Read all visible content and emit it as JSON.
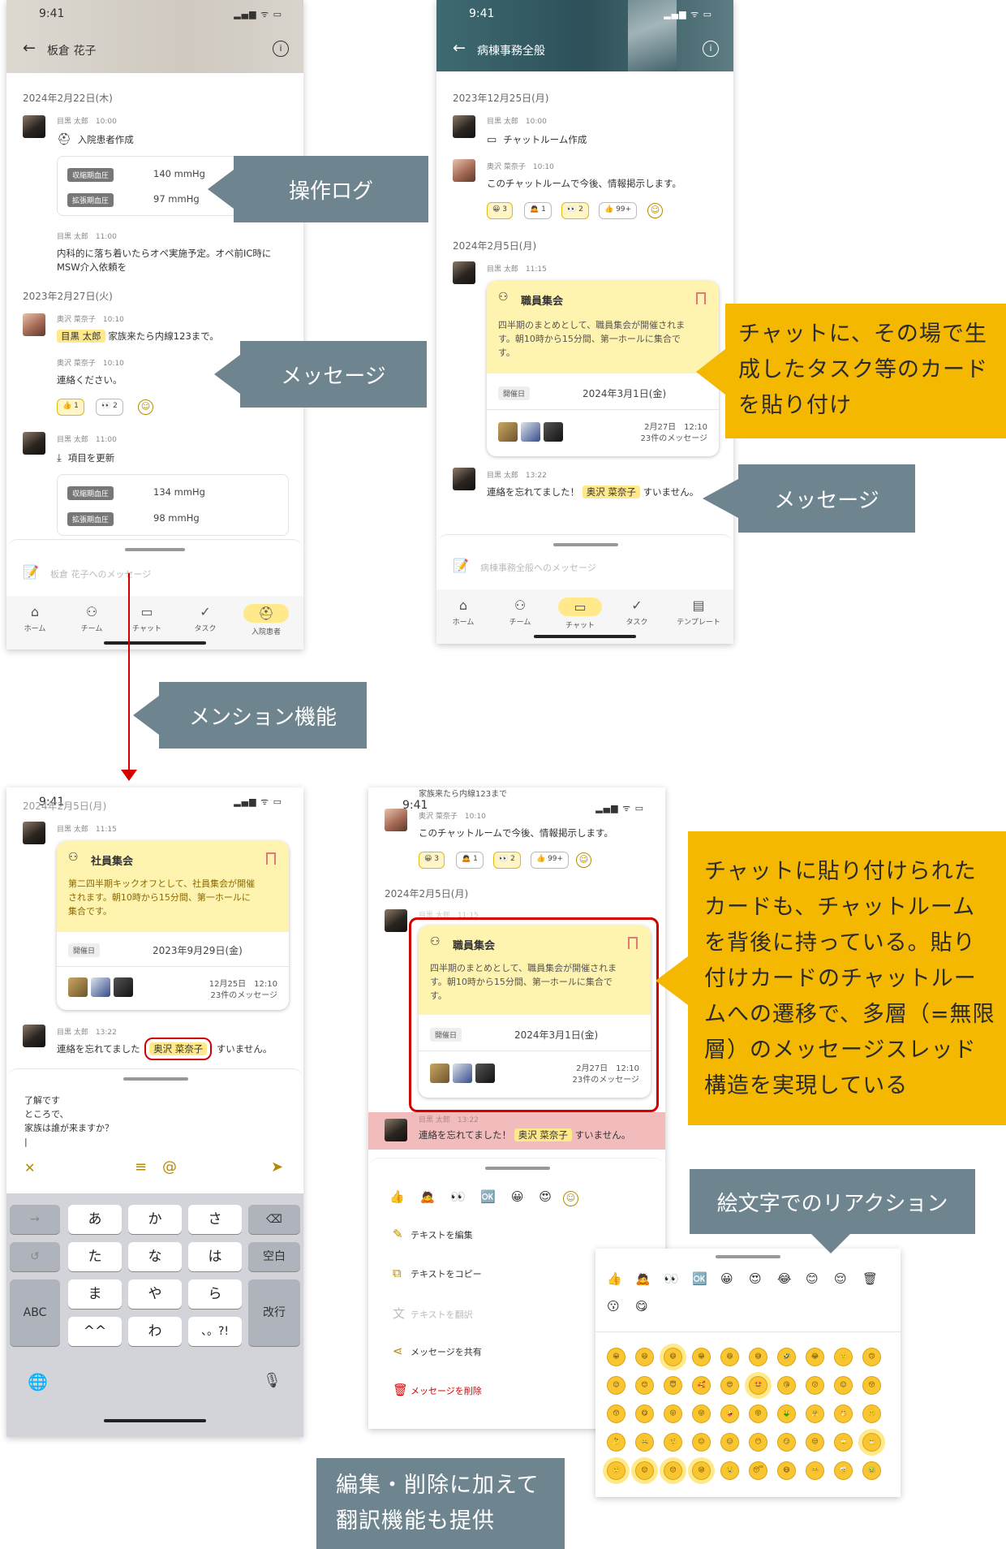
{
  "callouts": {
    "operation_log": "操作ログ",
    "message_1": "メッセージ",
    "card_paste": [
      "チャットに、その場で生",
      "成したタスク等のカード",
      "を貼り付け"
    ],
    "message_2": "メッセージ",
    "mention": "メンション機能",
    "card_thread": [
      "チャットに貼り付けられた",
      "カードも、チャットルーム",
      "を背後に持っている。貼り",
      "付けカードのチャットルー",
      "ムへの遷移で、多層（=無限",
      "層）のメッセージスレッド",
      "構造を実現している"
    ],
    "emoji_reaction": "絵文字でのリアクション",
    "edit_delete": [
      "編集・削除に加えて",
      "翻訳機能も提供"
    ]
  },
  "common": {
    "time": "9:41",
    "status_icons": "▂▄▆ ᯤ ▭",
    "back": "←",
    "info": "i"
  },
  "screen1": {
    "title": "板倉 花子",
    "date1": "2024年2月22日(木)",
    "m1_meta": "目黒 太郎　10:00",
    "m1_action": "入院患者作成",
    "vital_sys_label": "収縮期血圧",
    "vital_sys_value": "140 mmHg",
    "vital_dia_label": "拡張期血圧",
    "vital_dia_value": "97 mmHg",
    "m2_meta": "目黒 太郎　11:00",
    "m2_text_1": "内科的に落ち着いたらオペ実施予定。オペ前IC時に",
    "m2_text_2": "MSW介入依頼を",
    "date2": "2023年2月27日(火)",
    "m3_meta": "奥沢 菜奈子　10:10",
    "m3_mention": "目黒 太郎",
    "m3_text": "家族来たら内線123まで。",
    "m4_meta": "奥沢 菜奈子　10:10",
    "m4_text": "連絡ください。",
    "r1": "👍 1",
    "r2": "👀 2",
    "m5_meta": "目黒 太郎　11:00",
    "m5_action": "項目を更新",
    "vital2_sys_value": "134 mmHg",
    "vital2_dia_value": "98 mmHg",
    "input_placeholder": "板倉 花子へのメッセージ",
    "tabs": [
      "ホーム",
      "チーム",
      "チャット",
      "タスク",
      "入院患者"
    ]
  },
  "screen2": {
    "title": "病棟事務全般",
    "date1": "2023年12月25日(月)",
    "m1_meta": "目黒 太郎　10:00",
    "m1_action": "チャットルーム作成",
    "m2_meta": "奥沢 菜奈子　10:10",
    "m2_text": "このチャットルームで今後、情報掲示します。",
    "reactions": [
      "😀 3",
      "🙇 1",
      "👀 2",
      "👍 99+"
    ],
    "date2": "2024年2月5日(月)",
    "m3_meta": "目黒 太郎　11:15",
    "card_title": "職員集会",
    "card_body": [
      "四半期のまとめとして、職員集会が開催されま",
      "す。朝10時から15分間、第一ホールに集合で",
      "す。"
    ],
    "card_date_label": "開催日",
    "card_date": "2024年3月1日(金)",
    "card_footer_1": "2月27日　12:10",
    "card_footer_2": "23件のメッセージ",
    "m4_meta": "目黒 太郎　13:22",
    "m4_text_a": "連絡を忘れてました！",
    "m4_mention": "奥沢 菜奈子",
    "m4_text_b": "すいません。",
    "input_placeholder": "病棟事務全般へのメッセージ",
    "tabs": [
      "ホーム",
      "チーム",
      "チャット",
      "タスク",
      "テンプレート"
    ]
  },
  "screen3": {
    "date_behind": "2024年2月5日(月)",
    "m1_meta": "目黒 太郎　11:15",
    "card_title": "社員集会",
    "card_body": [
      "第二四半期キックオフとして、社員集会が開催",
      "されます。朝10時から15分間、第一ホールに",
      "集合です。"
    ],
    "card_date_label": "開催日",
    "card_date": "2023年9月29日(金)",
    "card_footer_1": "12月25日　12:10",
    "card_footer_2": "23件のメッセージ",
    "m2_meta": "目黒 太郎　13:22",
    "m2_text_a": "連絡を忘れてました",
    "m2_mention": "奥沢 菜奈子",
    "m2_text_b": "すいません。",
    "compose": [
      "了解です",
      "ところで、",
      "家族は誰が来ますか？"
    ],
    "close": "✕",
    "list_icon": "≡",
    "at_icon": "@",
    "send_icon": "➤",
    "keys": [
      "→",
      "あ",
      "か",
      "さ",
      "⌫",
      "↺",
      "た",
      "な",
      "は",
      "空白",
      "ABC",
      "ま",
      "や",
      "ら",
      "改行",
      "^^",
      "わ",
      "、。?!"
    ],
    "globe": "🌐",
    "mic": "🎙"
  },
  "screen4": {
    "top_text": "家族来たら内線123まで",
    "m1_meta": "奥沢 菜奈子　10:10",
    "m1_text": "このチャットルームで今後、情報掲示します。",
    "reactions": [
      "😀 3",
      "🙇 1",
      "👀 2",
      "👍 99+"
    ],
    "date": "2024年2月5日(月)",
    "m2_meta": "目黒 太郎　11:15",
    "card_title": "職員集会",
    "card_body": [
      "四半期のまとめとして、職員集会が開催されま",
      "す。朝10時から15分間、第一ホールに集合で",
      "す。"
    ],
    "card_date_label": "開催日",
    "card_date": "2024年3月1日(金)",
    "card_footer_1": "2月27日　12:10",
    "card_footer_2": "23件のメッセージ",
    "m3_meta": "目黒 太郎　13:22",
    "m3_text_a": "連絡を忘れてました！",
    "m3_mention": "奥沢 菜奈子",
    "m3_text_b": "すいません。",
    "quick_emoji": [
      "👍",
      "🙇",
      "👀",
      "🆗",
      "😀",
      "😍"
    ],
    "menu": [
      "テキストを編集",
      "テキストをコピー",
      "テキストを翻訳",
      "メッセージを共有",
      "メッセージを削除"
    ],
    "menu_icons": [
      "✎",
      "⧉",
      "文",
      "⋖",
      "🗑"
    ]
  },
  "emoji_panel": {
    "recent": [
      "👍",
      "🙇",
      "👀",
      "🆗",
      "😀",
      "😍",
      "😂",
      "😊",
      "😌",
      "🗑",
      "😗",
      "😋"
    ],
    "grid": [
      "😀",
      "😃",
      "😄",
      "😁",
      "😆",
      "😅",
      "🤣",
      "😂",
      "🙂",
      "🙃",
      "😉",
      "😊",
      "😇",
      "🥰",
      "😍",
      "🤩",
      "😘",
      "😗",
      "☺",
      "😚",
      "😙",
      "😋",
      "😛",
      "😜",
      "🤪",
      "😝",
      "🤑",
      "🤗",
      "🤭",
      "🤫",
      "🤔",
      "🤐",
      "🤨",
      "😐",
      "😑",
      "😶",
      "😏",
      "😒",
      "🙄",
      "😬",
      "🤥",
      "😌",
      "😔",
      "😪",
      "🤤",
      "😴",
      "😷",
      "🤒",
      "🤕",
      "🤢"
    ]
  },
  "colors": {
    "accent": "#ffe98a",
    "callout_gray": "#6e8590",
    "callout_yellow": "#f5b800",
    "mention_outline": "#d40000"
  }
}
